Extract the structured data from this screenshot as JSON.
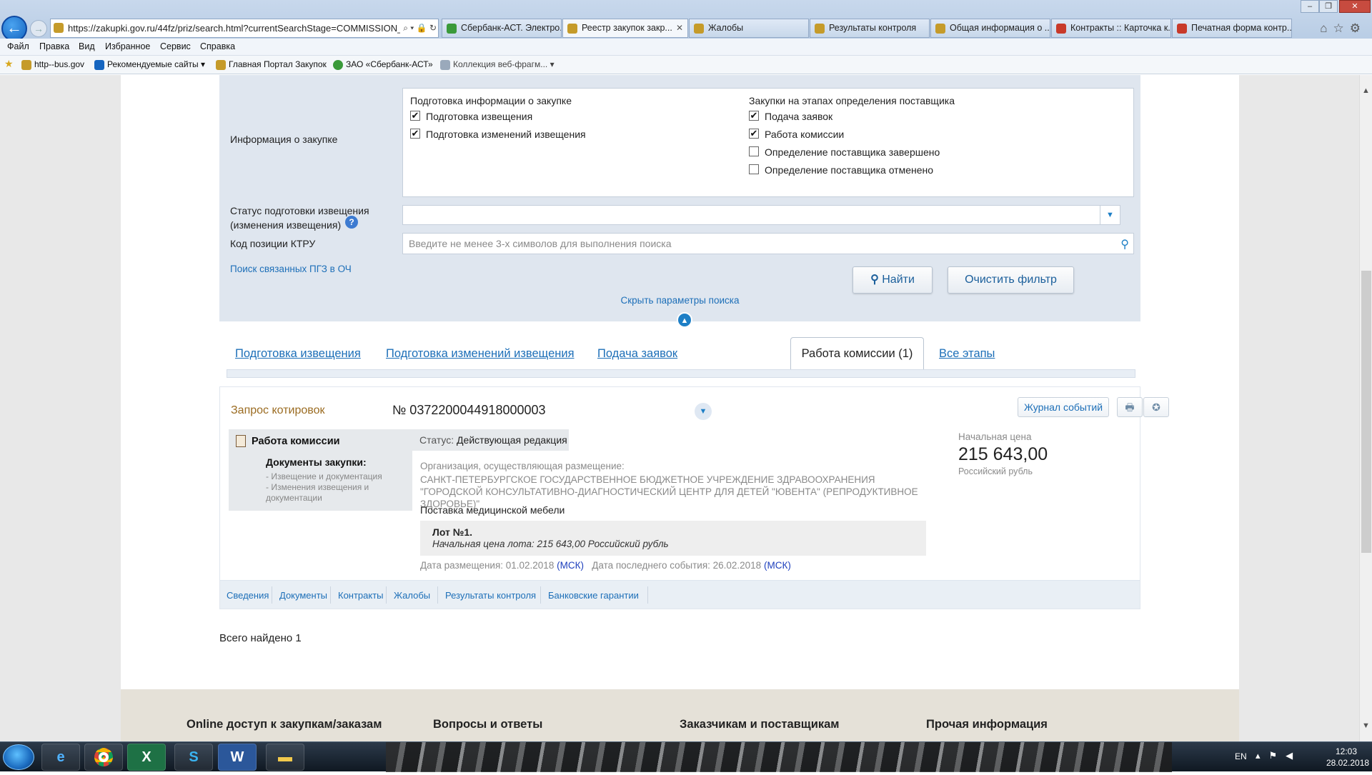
{
  "browser": {
    "address_url": "https://zakupki.gov.ru/44fz/priz/search.html?currentSearchStage=COMMISSION_AC",
    "address_controls": "⌕ ▾ 🔒 ↻",
    "tabs": [
      {
        "label": "Сбербанк-АСТ. Электро...",
        "color": "#3a9a3a"
      },
      {
        "label": "Реестр закупок закр...",
        "color": "#c59b2a"
      },
      {
        "label": "Жалобы",
        "color": "#c59b2a"
      },
      {
        "label": "Результаты контроля",
        "color": "#c59b2a"
      },
      {
        "label": "Общая информация о ...",
        "color": "#c59b2a"
      },
      {
        "label": "Контракты :: Карточка к...",
        "color": "#c83a2a"
      },
      {
        "label": "Печатная форма контр...",
        "color": "#c83a2a"
      }
    ],
    "close_glyph": "✕",
    "menu": [
      "Файл",
      "Правка",
      "Вид",
      "Избранное",
      "Сервис",
      "Справка"
    ],
    "favorites": [
      {
        "label": "http--bus.gov",
        "color": "#c59b2a"
      },
      {
        "label": "Рекомендуемые сайты ▾",
        "color": "#1565c0"
      },
      {
        "label": "Главная Портал Закупок",
        "color": "#c59b2a"
      },
      {
        "label": "ЗАО «Сбербанк-АСТ»",
        "color": "#3a9a3a"
      },
      {
        "label": "Коллекция веб-фрагм... ▾",
        "color": "#9aa9bb"
      }
    ]
  },
  "filter": {
    "info_label": "Информация о закупке",
    "group1_title": "Подготовка информации о закупке",
    "group1_items": [
      {
        "label": "Подготовка извещения",
        "checked": true
      },
      {
        "label": "Подготовка изменений извещения",
        "checked": true
      }
    ],
    "group2_title": "Закупки на этапах определения поставщика",
    "group2_items": [
      {
        "label": "Подача заявок",
        "checked": true
      },
      {
        "label": "Работа комиссии",
        "checked": true
      },
      {
        "label": "Определение поставщика завершено",
        "checked": false
      },
      {
        "label": "Определение поставщика отменено",
        "checked": false
      }
    ],
    "status_label_line1": "Статус подготовки извещения",
    "status_label_line2": "(изменения извещения)",
    "status_value": "",
    "ktru_label": "Код позиции КТРУ",
    "ktru_placeholder": "Введите не менее 3-х символов для выполнения поиска",
    "related_link": "Поиск связанных ПГЗ в ОЧ",
    "find_button": "Найти",
    "clear_button": "Очистить фильтр",
    "hide_link": "Скрыть параметры поиска"
  },
  "stage_tabs": [
    "Подготовка извещения",
    "Подготовка изменений извещения",
    "Подача заявок",
    "Работа комиссии (1)",
    "Все этапы"
  ],
  "result": {
    "type": "Запрос котировок",
    "number": "№ 0372200044918000003",
    "journal_button": "Журнал событий",
    "stage": "Работа комиссии",
    "docs_title": "Документы закупки:",
    "doc_links": [
      "- Извещение и документация",
      "- Изменения извещения и",
      "документации"
    ],
    "status_label": "Статус:",
    "status_value": "Действующая редакция",
    "org_label": "Организация, осуществляющая размещение:",
    "org_name": "САНКТ-ПЕТЕРБУРГСКОЕ ГОСУДАРСТВЕННОЕ БЮДЖЕТНОЕ УЧРЕЖДЕНИЕ ЗДРАВООХРАНЕНИЯ \"ГОРОДСКОЙ КОНСУЛЬТАТИВНО-ДИАГНОСТИЧЕСКИЙ ЦЕНТР ДЛЯ ДЕТЕЙ \"ЮВЕНТА\" (РЕПРОДУКТИВНОЕ ЗДОРОВЬЕ)\"",
    "subject": "Поставка медицинской мебели",
    "lot_title": "Лот №1.",
    "lot_price": "Начальная цена лота: 215 643,00 Российский рубль",
    "date_posted_label": "Дата размещения: 01.02.2018",
    "msk": "(МСК)",
    "date_event_label": "Дата последнего события: 26.02.2018",
    "price_label": "Начальная цена",
    "price_value": "215 643,00",
    "price_currency": "Российский рубль",
    "links": [
      "Сведения",
      "Документы",
      "Контракты",
      "Жалобы",
      "Результаты контроля",
      "Банковские гарантии"
    ]
  },
  "total": "Всего найдено 1",
  "footer": [
    "Online доступ к закупкам/заказам",
    "Вопросы и ответы",
    "Заказчикам и поставщикам",
    "Прочая информация"
  ],
  "taskbar": {
    "lang": "EN",
    "time": "12:03",
    "date": "28.02.2018"
  }
}
